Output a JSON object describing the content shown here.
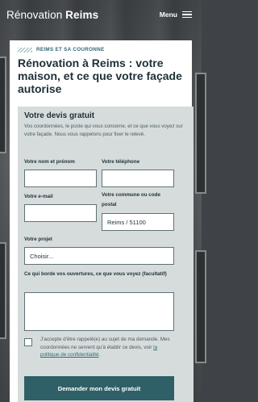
{
  "header": {
    "brand_light": "Rénovation",
    "brand_bold": "Reims",
    "menu_label": "Menu"
  },
  "hero": {
    "eyebrow": "REIMS ET SA COURONNE",
    "headline_1": "Rénovation à ",
    "headline_bold_1": "Reims",
    "headline_2": " : votre maison, et ce que votre ",
    "headline_bold_2": "façade",
    "headline_3": " autorise"
  },
  "form": {
    "title": "Votre devis gratuit",
    "intro": "Vos coordonnées, le poste qui vous concerne, et ce que vous voyez sur votre façade. Nous vous rappelons pour fixer le relevé.",
    "name_label": "Votre nom et prénom",
    "name_value": "",
    "phone_label": "Votre téléphone",
    "phone_value": "",
    "email_label": "Votre e-mail",
    "email_value": "",
    "commune_label": "Votre commune ou code postal",
    "commune_value": "Reims / 51100",
    "project_label": "Votre projet",
    "project_selected": "Choisir...",
    "observation_label": "Ce qui borde vos ouvertures, ce que vous voyez (facultatif)",
    "observation_value": "",
    "consent_text": "J'accepte d'être rappelé(e) au sujet de ma demande. Mes coordonnées ne servent qu'à établir ce devis, voir ",
    "consent_link": "la politique de confidentialité",
    "consent_end": ".",
    "consent_checked": false,
    "submit_label": "Demander mon devis gratuit"
  },
  "colors": {
    "accent": "#2f5f67",
    "form_bg": "#d6dcdc",
    "eyebrow": "#2f6a73"
  }
}
